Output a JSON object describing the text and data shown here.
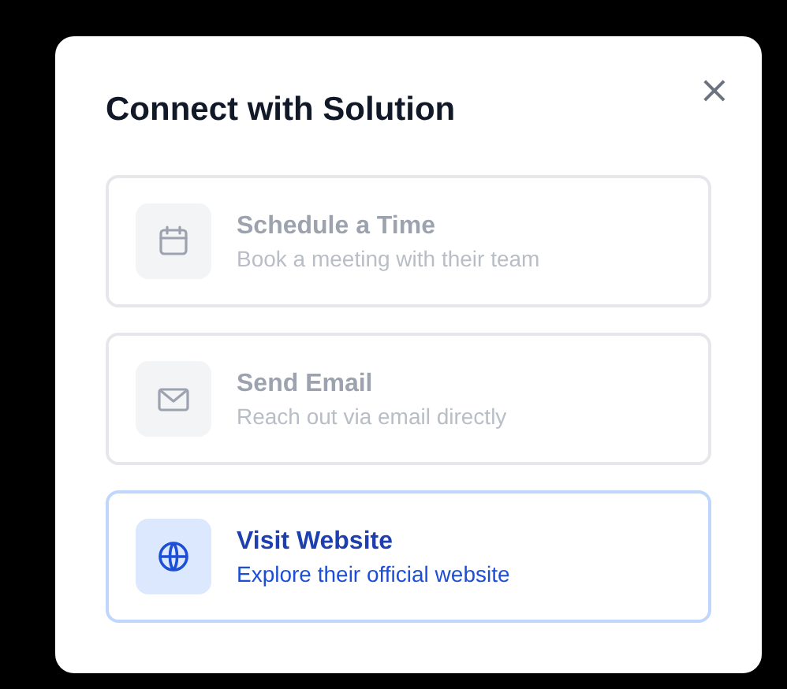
{
  "dialog": {
    "title": "Connect with Solution",
    "close": "×"
  },
  "options": [
    {
      "kind": "calendar",
      "title": "Schedule a Time",
      "description": "Book a meeting with their team",
      "disabled": true,
      "selected": false
    },
    {
      "kind": "email",
      "title": "Send Email",
      "description": "Reach out via email directly",
      "disabled": true,
      "selected": false
    },
    {
      "kind": "website",
      "title": "Visit Website",
      "description": "Explore their official website",
      "disabled": false,
      "selected": true
    }
  ]
}
